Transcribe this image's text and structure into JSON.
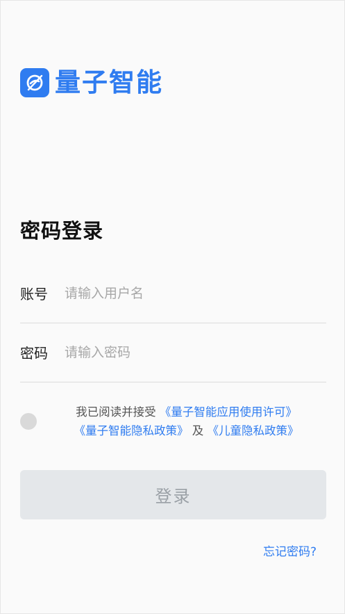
{
  "brand": {
    "name": "量子智能",
    "color": "#2f7cf0"
  },
  "page_title": "密码登录",
  "form": {
    "account_label": "账号",
    "account_placeholder": "请输入用户名",
    "password_label": "密码",
    "password_placeholder": "请输入密码"
  },
  "agreement": {
    "prefix": "我已阅读并接受",
    "license_link": "《量子智能应用使用许可》",
    "privacy_link": "《量子智能隐私政策》",
    "and_text": "及",
    "child_privacy_link": "《儿童隐私政策》"
  },
  "login_button": "登录",
  "forgot_password": "忘记密码?"
}
